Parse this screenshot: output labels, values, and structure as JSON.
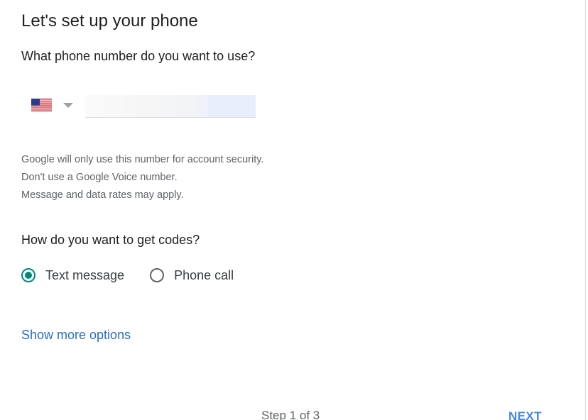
{
  "header": {
    "title": "Let's set up your phone"
  },
  "phone": {
    "question": "What phone number do you want to use?",
    "country_icon": "us-flag-icon",
    "country_code": "US",
    "number_value": "",
    "info_lines": [
      "Google will only use this number for account security.",
      "Don't use a Google Voice number.",
      "Message and data rates may apply."
    ]
  },
  "codes": {
    "question": "How do you want to get codes?",
    "options": [
      {
        "label": "Text message",
        "selected": true
      },
      {
        "label": "Phone call",
        "selected": false
      }
    ]
  },
  "links": {
    "show_more": "Show more options"
  },
  "footer": {
    "step": "Step 1 of 3",
    "next_label": "NEXT"
  },
  "colors": {
    "accent": "#00897b",
    "link": "#2a6cc8",
    "primary_button": "#4285f4"
  }
}
